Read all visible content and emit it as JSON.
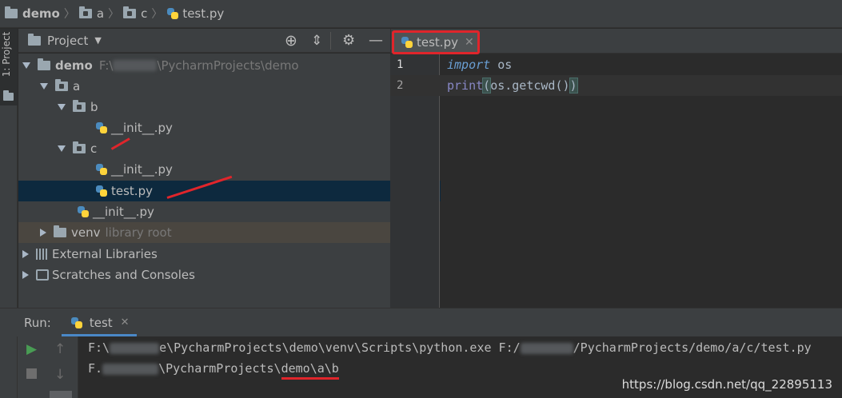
{
  "breadcrumb": [
    "demo",
    "a",
    "c",
    "test.py"
  ],
  "left_strip": {
    "project_label": "1: Project"
  },
  "project_panel": {
    "title": "Project",
    "tree": [
      {
        "label": "demo",
        "extra": "F:\\",
        "extra2": "\\PycharmProjects\\demo"
      },
      {
        "label": "a"
      },
      {
        "label": "b"
      },
      {
        "label": "__init__.py"
      },
      {
        "label": "c"
      },
      {
        "label": "__init__.py"
      },
      {
        "label": "test.py"
      },
      {
        "label": "__init__.py"
      },
      {
        "label": "venv",
        "extra": "library root"
      },
      {
        "label": "External Libraries"
      },
      {
        "label": "Scratches and Consoles"
      }
    ]
  },
  "editor": {
    "tab": "test.py",
    "line_numbers": [
      "1",
      "2"
    ],
    "code": {
      "line1_keyword": "import",
      "line1_rest": " os",
      "line2_fn": "print",
      "line2_open": "(",
      "line2_mid": "os.getcwd()",
      "line2_close": ")"
    }
  },
  "run": {
    "label": "Run:",
    "tab": "test",
    "console": {
      "line1_a": "F:\\",
      "line1_b": "e\\PycharmProjects\\demo\\venv\\Scripts\\python.exe F:/",
      "line1_c": "/PycharmProjects/demo/a/c/test.py",
      "line2_a": "F.",
      "line2_b": "\\PycharmProjects\\",
      "line2_c": "demo\\a\\b"
    },
    "watermark": "https://blog.csdn.net/qq_22895113"
  },
  "colors": {
    "accent_red": "#e0252b",
    "selection": "#0d293e",
    "venv_row": "#4a4640"
  }
}
